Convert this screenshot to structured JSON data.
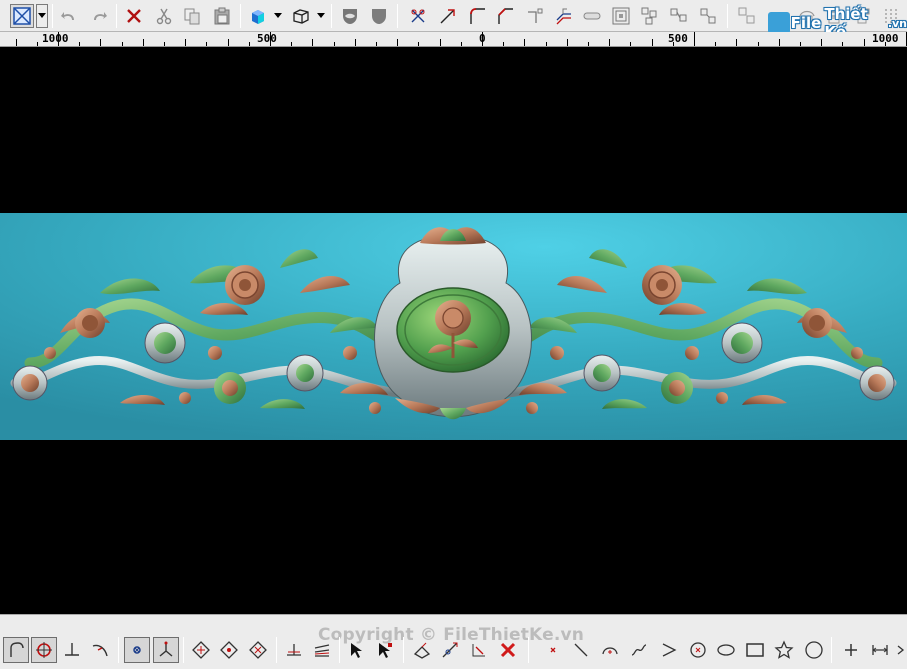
{
  "watermark": {
    "logo_main": "File",
    "logo_rest": "Thiết Kế",
    "logo_suffix": ".vn",
    "copyright": "Copyright © FileThietKe.vn"
  },
  "ruler": {
    "labels": [
      "1000",
      "500",
      "0",
      "500",
      "1000"
    ]
  },
  "colors": {
    "toolbar_bg": "#ececec",
    "viewport_bg": "#000000",
    "relief_background": "#3fb8cc",
    "relief_green": "#5fa860",
    "relief_copper": "#b97a5a",
    "relief_silver": "#b9c3c4",
    "accent_blue": "#1e6fd0",
    "accent_red": "#d01a1a"
  },
  "top_toolbar": {
    "icons": [
      "select-box-icon",
      "undo-icon",
      "redo-icon",
      "delete-icon",
      "cut-icon",
      "copy-icon",
      "paste-icon",
      "shaded-cube-icon",
      "wireframe-cube-icon",
      "face-relief-icon",
      "shield-relief-icon",
      "trim-icon",
      "extend-icon",
      "fillet-icon",
      "chamfer-icon",
      "break-icon",
      "offset-icon",
      "slot-icon",
      "nested-square-icon",
      "array-icon",
      "mirror-icon",
      "move-icon",
      "align-icon",
      "group-icon",
      "ungroup-icon",
      "boolean-icon"
    ]
  },
  "bottom_toolbar": {
    "icons": [
      "arc-snap-icon",
      "circle-snap-icon",
      "perpendicular-icon",
      "tangent-icon",
      "center-snap-icon",
      "axis-icon",
      "node-edit-icon",
      "node-add-icon",
      "node-delete-icon",
      "layer-icon",
      "layers-icon",
      "pointer-icon",
      "pointer-node-icon",
      "transform-icon",
      "scale-icon",
      "measure-icon",
      "delete-x-icon",
      "point-icon",
      "line-icon",
      "arc-icon",
      "spline-icon",
      "polyline-icon",
      "circle-icon",
      "ellipse-icon",
      "rectangle-icon",
      "star-icon",
      "polygon-icon",
      "cross-icon",
      "dimension-icon",
      "extra-icon"
    ]
  }
}
